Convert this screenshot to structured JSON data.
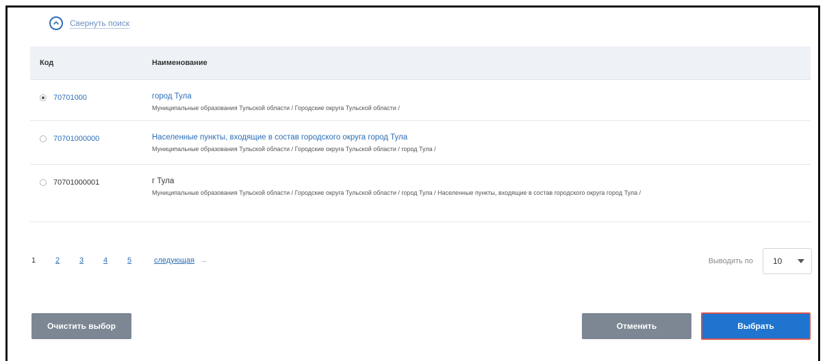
{
  "collapse": {
    "label": "Свернуть поиск"
  },
  "table": {
    "headers": {
      "code": "Код",
      "name": "Наименование"
    },
    "rows": [
      {
        "code": "70701000",
        "name": "город Тула",
        "path": "Муниципальные образования Тульской области / Городские округа Тульской области /",
        "selected": true
      },
      {
        "code": "70701000000",
        "name": "Населенные пункты, входящие в состав городского округа город Тула",
        "path": "Муниципальные образования Тульской области / Городские округа Тульской области / город Тула /",
        "selected": false
      },
      {
        "code": "70701000001",
        "name": "г Тула",
        "path": "Муниципальные образования Тульской области / Городские округа Тульской области / город Тула / Населенные пункты, входящие в состав городского округа город Тула /",
        "selected": false
      }
    ]
  },
  "pagination": {
    "pages": [
      "1",
      "2",
      "3",
      "4",
      "5"
    ],
    "current": "1",
    "next_label": "следующая",
    "next_arrow": "→"
  },
  "per_page": {
    "label": "Выводить по",
    "value": "10"
  },
  "buttons": {
    "clear": "Очистить выбор",
    "cancel": "Отменить",
    "select": "Выбрать"
  },
  "colors": {
    "accent": "#1f74cf",
    "link": "#2a6db5",
    "button_gray": "#7d8793",
    "header_bg": "#eef2f7"
  }
}
